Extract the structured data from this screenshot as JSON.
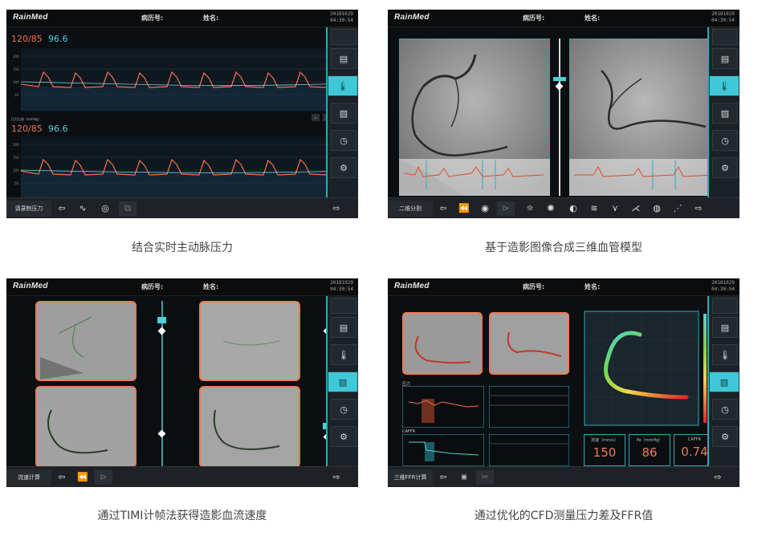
{
  "app": {
    "logo": "RainMed",
    "field_record": "病历号:",
    "field_name": "姓名:",
    "date": "20181029",
    "time": "04:30:54"
  },
  "sidebar_icons": [
    "document-icon",
    "thermometer-icon",
    "image-icon",
    "clock-icon",
    "gear-icon"
  ],
  "panels": [
    {
      "mode_label": "请录制压力",
      "caption": "结合实时主动脉压力",
      "bp_top": "120/85",
      "spo_top": "96.6",
      "bp_bottom": "120/85",
      "spo_bottom": "96.6",
      "subheader": "压力记录（mmHg）"
    },
    {
      "mode_label": "二维分割",
      "caption": "基于造影图像合成三维血管模型"
    },
    {
      "mode_label": "流速计算",
      "caption": "通过TIMI计帧法获得造影血流速度"
    },
    {
      "mode_label": "三维FFR计算",
      "caption": "通过优化的CFD测量压力差及FFR值",
      "flow_label": "流速（mm/s）",
      "flow_value": "150",
      "pa_label": "Pa（mmHg）",
      "pa_value": "86",
      "caffr_label": "CAFFR",
      "caffr_value": "0.74",
      "chart_title_1": "压力",
      "chart_title_2": "CAFFR"
    }
  ]
}
